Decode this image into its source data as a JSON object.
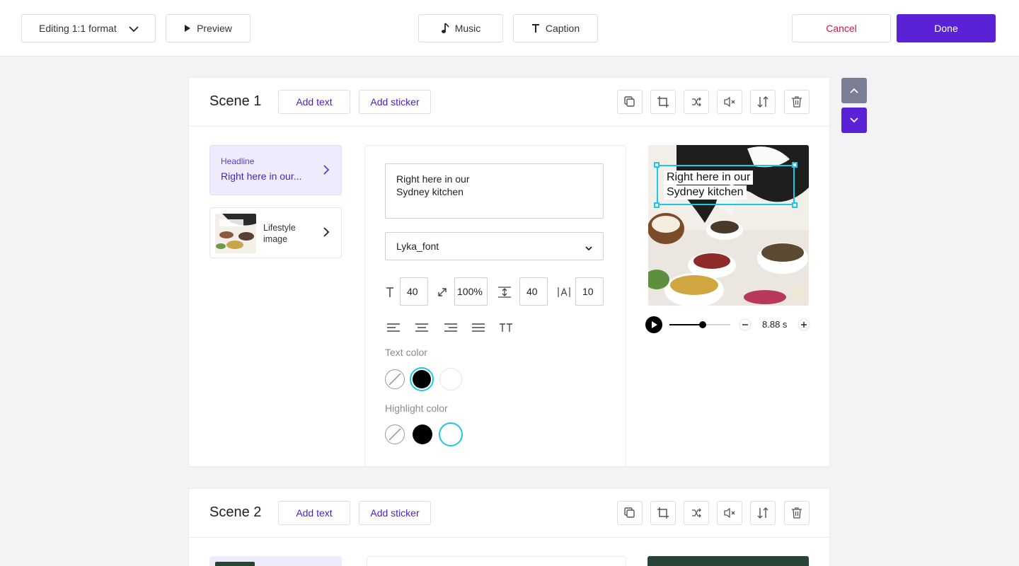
{
  "toolbar": {
    "format_label": "Editing 1:1 format",
    "preview_label": "Preview",
    "music_label": "Music",
    "caption_label": "Caption",
    "cancel_label": "Cancel",
    "done_label": "Done"
  },
  "scenes": [
    {
      "title": "Scene 1",
      "add_text_label": "Add text",
      "add_sticker_label": "Add sticker",
      "tools": [
        "duplicate-icon",
        "crop-icon",
        "shuffle-icon",
        "mute-icon",
        "swap-order-icon",
        "trash-icon"
      ],
      "layers": [
        {
          "label": "Headline",
          "value": "Right here in our..."
        },
        {
          "label": "Lifestyle image"
        }
      ],
      "editor": {
        "text": "Right here in our\nSydney kitchen",
        "font": "Lyka_font",
        "font_size": "40",
        "scale": "100%",
        "line_height": "40",
        "letter_spacing": "10",
        "text_color_label": "Text color",
        "highlight_color_label": "Highlight color",
        "text_colors": [
          "none",
          "#000000",
          "#ffffff"
        ],
        "highlight_colors": [
          "none",
          "#000000",
          "#ffffff"
        ],
        "selected_text_color": "#000000",
        "selected_highlight_color": "#ffffff"
      },
      "preview": {
        "caption_line1": "Right here in our",
        "caption_line2": "Sydney kitchen",
        "duration": "8.88 s",
        "progress": 0.55
      }
    },
    {
      "title": "Scene 2",
      "add_text_label": "Add text",
      "add_sticker_label": "Add sticker"
    }
  ],
  "colors": {
    "accent": "#5a22d6",
    "cancel": "#d0154a",
    "selection": "#1cc6e6"
  }
}
